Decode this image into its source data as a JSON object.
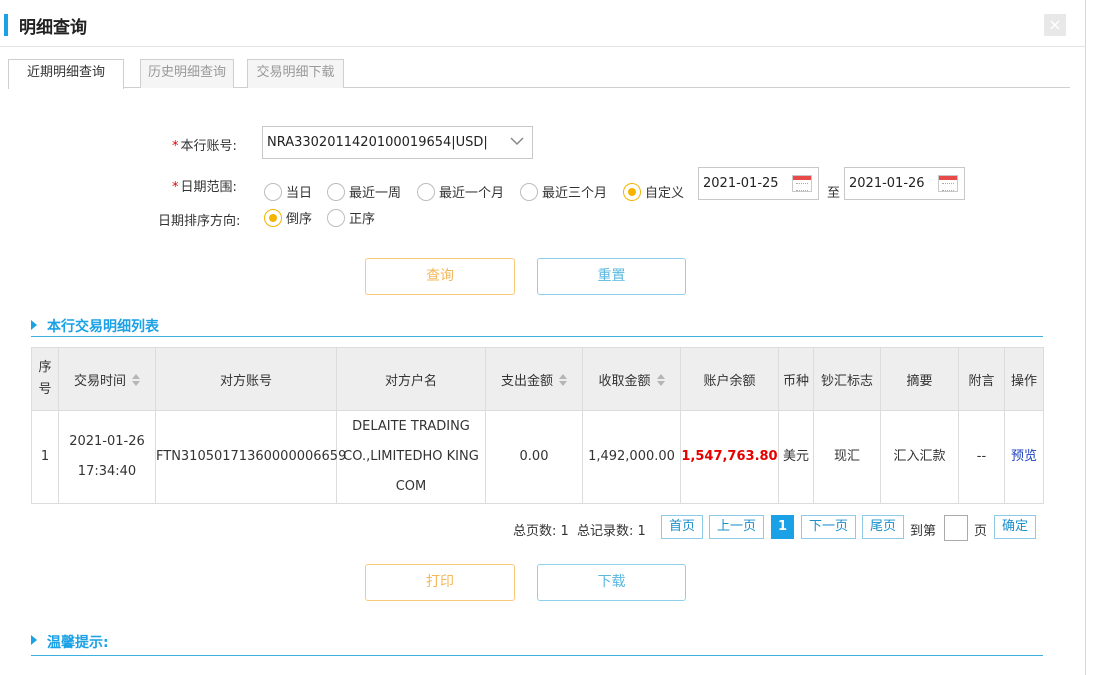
{
  "header": {
    "title": "明细查询",
    "close_glyph": "×"
  },
  "tabs": [
    {
      "label": "近期明细查询",
      "active": true
    },
    {
      "label": "历史明细查询",
      "active": false
    },
    {
      "label": "交易明细下载",
      "active": false
    }
  ],
  "form": {
    "account_label": "本行账号:",
    "account_value": "NRA3302011420100019654|USD|",
    "date_range_label": "日期范围:",
    "date_range_options": [
      {
        "label": "当日",
        "checked": false
      },
      {
        "label": "最近一周",
        "checked": false
      },
      {
        "label": "最近一个月",
        "checked": false
      },
      {
        "label": "最近三个月",
        "checked": false
      },
      {
        "label": "自定义",
        "checked": true
      }
    ],
    "start_date": "2021-01-25",
    "to_label": "至",
    "end_date": "2021-01-26",
    "sort_label": "日期排序方向:",
    "sort_options": [
      {
        "label": "倒序",
        "checked": true
      },
      {
        "label": "正序",
        "checked": false
      }
    ],
    "required_mark": "*",
    "query_button": "查询",
    "reset_button": "重置"
  },
  "list_section": {
    "title": "本行交易明细列表"
  },
  "table": {
    "headers": [
      "序号",
      "交易时间",
      "对方账号",
      "对方户名",
      "支出金额",
      "收取金额",
      "账户余额",
      "币种",
      "钞汇标志",
      "摘要",
      "附言",
      "操作"
    ],
    "rows": [
      {
        "index": "1",
        "date": "2021-01-26",
        "time": "17:34:40",
        "counter_account": "FTN31050171360000006659",
        "counter_name_line1": "DELAITE TRADING",
        "counter_name_line2": "CO.,LIMITEDHO KING",
        "counter_name_line3": "COM",
        "debit": "0.00",
        "credit": "1,492,000.00",
        "balance": "1,547,763.80",
        "currency": "美元",
        "cash_flag": "现汇",
        "summary": "汇入汇款",
        "remark": "--",
        "action": "预览"
      }
    ]
  },
  "pagination": {
    "total_pages_label": "总页数:",
    "total_pages": "1",
    "total_records_label": "总记录数:",
    "total_records": "1",
    "first": "首页",
    "prev": "上一页",
    "current": "1",
    "next": "下一页",
    "last": "尾页",
    "goto_label": "到第",
    "page_unit": "页",
    "confirm": "确定"
  },
  "actions": {
    "print": "打印",
    "download": "下载"
  },
  "tips_section": {
    "title": "温馨提示:"
  },
  "colors": {
    "accent": "#1aa1e6",
    "radio_checked": "#f5b400",
    "balance": "#e60000"
  }
}
